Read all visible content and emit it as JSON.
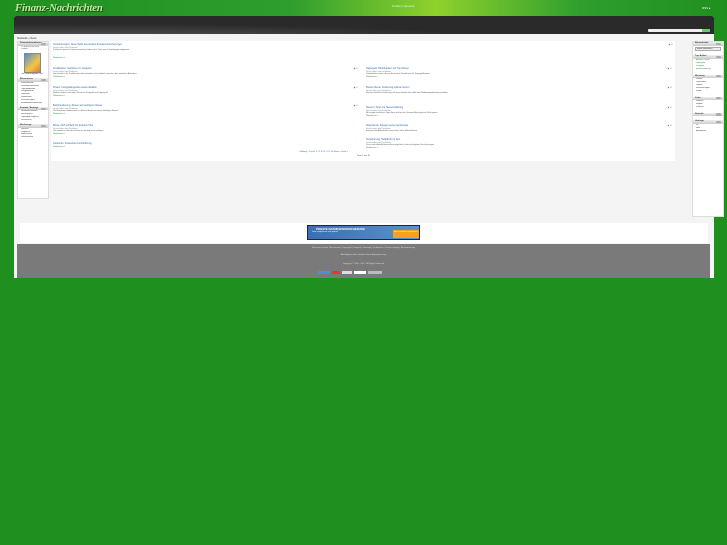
{
  "site": {
    "logo": "Finanz-Nachrichten",
    "top_links": "Kontakt | Impressum",
    "top_right": "RSS ▸",
    "breadcrumb": "Startseite » News"
  },
  "left": {
    "box1_title": "Finanzinformationen",
    "box1_items": [
      "» Finanznachrichten",
      "» News"
    ],
    "box1_caption": "Der Finanzratgeber 2007",
    "partner_title": "Börsenforen",
    "partner_items": [
      "Partnerbörsen",
      "Finanzinformationen",
      "Tagesgeldkonto",
      "Festgeldkonto",
      "Girokonto",
      "Kreditkarten",
      "Versicherungen",
      "Immobilienfinanzierung"
    ],
    "contact_title": "Kontakt / Anfrage",
    "contact_items": [
      "Finanznachrichten",
      "Börsenportal",
      "Tagesgeld Vergleich",
      "Zinsrechner"
    ],
    "tools_title": "Werkzeuge",
    "tools_items": [
      "Rechner",
      "Vergleiche",
      "Börsenkurse",
      "Devisenkurse"
    ]
  },
  "articles_left": [
    {
      "title": "Versicherungen: Neue Tarife bei privaten Krankenversicherungen",
      "meta": "Geschrieben von Redaktion",
      "text": "Zahlreiche private Krankenversicherer haben ihre Tarife zum Jahresbeginn angepasst.",
      "more": "Weiterlesen »"
    },
    {
      "title": "Kreditkarten: Gebühren im Vergleich",
      "meta": "Geschrieben von Redaktion",
      "text": "Die Gebühren für Kreditkarten unterscheiden sich erheblich zwischen den einzelnen Anbietern.",
      "more": "Weiterlesen »"
    },
    {
      "title": "Zinsen: Festgeldangebote weiter attraktiv",
      "meta": "Geschrieben von Redaktion",
      "text": "Banken werben mit hohen Zinsen für Festgeld und Tagesgeld.",
      "more": "Weiterlesen »"
    },
    {
      "title": "Baufinanzierung: Zinsen auf niedrigem Niveau",
      "meta": "Geschrieben von Redaktion",
      "text": "Die Bauzinsen bleiben auch in diesem Monat auf einem niedrigen Niveau.",
      "more": "Weiterlesen »"
    },
    {
      "title": "Börse: DAX schließt mit leichtem Plus",
      "meta": "Geschrieben von Redaktion",
      "text": "Der deutsche Leitindex konnte am Freitag leicht zulegen.",
      "more": "Weiterlesen »"
    },
    {
      "title": "Girokonto: Kostenlose Kontoführung",
      "meta": "Geschrieben von Redaktion",
      "text": "Immer mehr Banken bieten ein kostenloses Girokonto an.",
      "more": "Weiterlesen »"
    }
  ],
  "articles_right": [
    {
      "title": "Tagesgeld: Direktbanken mit Top-Zinsen",
      "meta": "Geschrieben von Redaktion",
      "text": "Direktbanken bieten derzeit die besten Konditionen für Tagesgeldkonten.",
      "more": "Weiterlesen »"
    },
    {
      "title": "Riester-Rente: Förderung optimal nutzen",
      "meta": "Geschrieben von Redaktion",
      "text": "Wer die staatliche Förderung voll ausschöpfen will, sollte den Mindesteigenbeitrag einzahlen.",
      "more": "Weiterlesen »"
    },
    {
      "title": "Steuern: Tipps zur Steuererklärung",
      "meta": "Geschrieben von Redaktion",
      "text": "Mit einigen einfachen Tipps lässt sich bei der Steuererklärung bares Geld sparen.",
      "more": "Weiterlesen »"
    },
    {
      "title": "Aktienfonds: Anleger setzen auf Europa",
      "meta": "Geschrieben von Redaktion",
      "text": "Europäische Aktienfonds verzeichnen hohe Mittelzuflüsse.",
      "more": "Weiterlesen »"
    },
    {
      "title": "Versicherung: Haftpflicht im Test",
      "meta": "Geschrieben von Redaktion",
      "text": "Die private Haftpflichtversicherung gehört zu den wichtigsten Versicherungen.",
      "more": "Weiterlesen »"
    }
  ],
  "pager": "« Anfang < Zurück 1 2 3 4 5 6 7 8 9 10 Weiter > Ende »",
  "pager2": "Seite 1 von 48",
  "right": {
    "box1_title": "Börsenbriefe",
    "box1_btn": "Börse auswählen",
    "box2_title": "Top-Artikel",
    "box2_items": [
      "Aktuelle Zinsen",
      "Tagesgeld",
      "Festgeld",
      "Baufinanzierung"
    ],
    "box3_title": "Werbung",
    "box3_items": [
      "Kredite",
      "Girokonten",
      "Depots",
      "Versicherungen",
      "Fonds"
    ],
    "box4_title": "Links",
    "box4_items": [
      "Deutsch",
      "English",
      "Français"
    ],
    "box5_title": "Statistik",
    "box6_title": "Umfrage",
    "box6_items": [
      "Ja",
      "Nein",
      "Abstimmen"
    ]
  },
  "ad": {
    "title": "PRIVATE KRANKENVERSICHERUNG",
    "sub": "Jetzt vergleichen und sparen!",
    "btn": "Hier kostenlos vergleichen"
  },
  "footer": {
    "line1": "Finanznachrichten | Börsennews | Tagesgeld | Festgeld | Girokonto | Kreditkarten | Versicherungen | Baufinanzierung",
    "line2": "Alle Angaben ohne Gewähr. Keine Anlageberatung.",
    "line3": "Copyright © 2006 - 2007 - All Rights Reserved"
  },
  "colors": {
    "brand": "#1f8f1f",
    "link": "#2a6ab0",
    "header": "#2a2a2a"
  }
}
